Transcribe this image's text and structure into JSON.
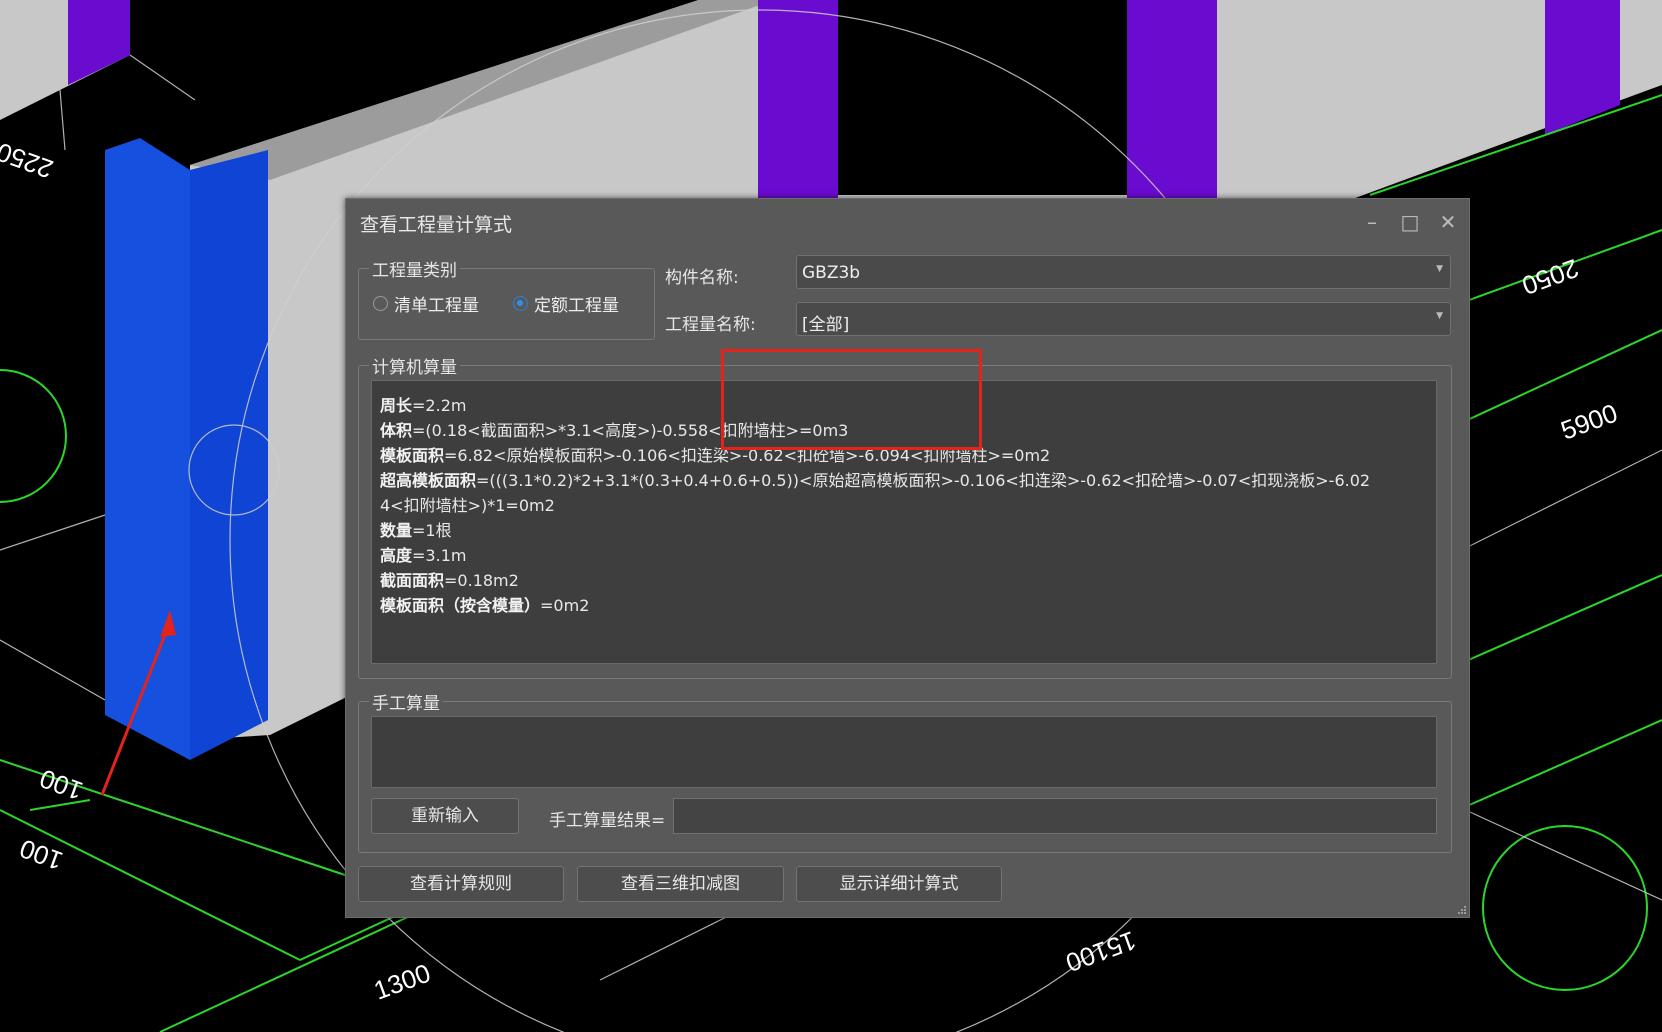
{
  "dialog": {
    "title": "查看工程量计算式",
    "window_buttons": {
      "minimize": "–",
      "maximize": "□",
      "close": "✕"
    },
    "quantity_type": {
      "legend": "工程量类别",
      "options": [
        {
          "label": "清单工程量",
          "selected": false
        },
        {
          "label": "定额工程量",
          "selected": true
        }
      ]
    },
    "component_name": {
      "label": "构件名称:",
      "value": "GBZ3b"
    },
    "quantity_name": {
      "label": "工程量名称:",
      "value": "[全部]"
    },
    "computer_calc": {
      "legend": "计算机算量",
      "lines": [
        {
          "name": "周长",
          "expr": "=2.2m"
        },
        {
          "name": "体积",
          "expr": "=(0.18<截面面积>*3.1<高度>)-0.558<扣附墙柱>=0m3"
        },
        {
          "name": "模板面积",
          "expr": "=6.82<原始模板面积>-0.106<扣连梁>-0.62<扣砼墙>-6.094<扣附墙柱>=0m2"
        },
        {
          "name": "超高模板面积",
          "expr": "=(((3.1*0.2)*2+3.1*(0.3+0.4+0.6+0.5))<原始超高模板面积>-0.106<扣连梁>-0.62<扣砼墙>-0.07<扣现浇板>-6.02"
        },
        {
          "name": "",
          "expr": "4<扣附墙柱>)*1=0m2"
        },
        {
          "name": "数量",
          "expr": "=1根"
        },
        {
          "name": "高度",
          "expr": "=3.1m"
        },
        {
          "name": "截面面积",
          "expr": "=0.18m2"
        },
        {
          "name": "模板面积（按含模量）",
          "expr": "=0m2"
        }
      ]
    },
    "manual_calc": {
      "legend": "手工算量",
      "reinput_button": "重新输入",
      "result_label": "手工算量结果=",
      "result_value": ""
    },
    "bottom_buttons": {
      "view_rules": "查看计算规则",
      "view_3d": "查看三维扣减图",
      "show_detail": "显示详细计算式"
    }
  },
  "cad_labels": [
    "5900",
    "2050",
    "1300",
    "15100",
    "100",
    "100",
    "2250"
  ],
  "colors": {
    "dialog_bg": "#595959",
    "column_blue": "#1447d6",
    "wall_gray": "#c8c8c8",
    "purple_column": "#6a0bd0",
    "cad_green": "#2bd62b",
    "highlight_red": "#e3231c",
    "radio_accent": "#2f8ff0"
  }
}
